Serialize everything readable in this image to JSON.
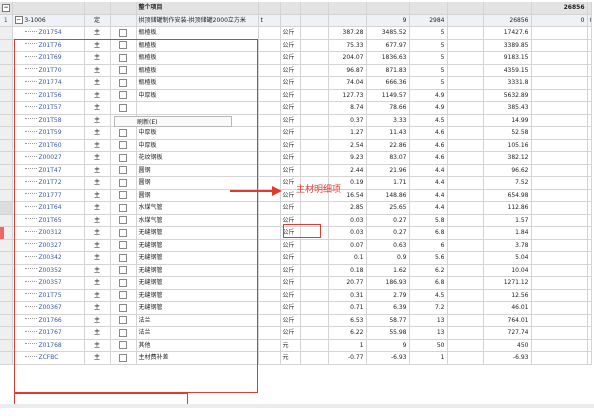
{
  "header": {
    "icon": "−",
    "title": "整个项目",
    "total": "26856"
  },
  "group": {
    "index": "1",
    "code": "3-1006",
    "type": "定",
    "name": "拱顶储罐制作安装-拱顶储罐2000立方米",
    "unit": "t",
    "c1": "9",
    "c2": "2984",
    "c3": "26856",
    "c4": "0",
    "c5": "0"
  },
  "rows": [
    {
      "code": "Z01754",
      "type": "主",
      "name": "瓶楂板",
      "unit": "公斤",
      "q": "387.28",
      "v1": "3485.52",
      "p": "5",
      "t": "17427.6"
    },
    {
      "code": "Z01T76",
      "type": "主",
      "name": "瓶楂板",
      "unit": "公斤",
      "q": "75.33",
      "v1": "677.97",
      "p": "5",
      "t": "3389.85"
    },
    {
      "code": "Z01T69",
      "type": "主",
      "name": "瓶楂板",
      "unit": "公斤",
      "q": "204.07",
      "v1": "1836.63",
      "p": "5",
      "t": "9183.15"
    },
    {
      "code": "Z01T70",
      "type": "主",
      "name": "瓶楂板",
      "unit": "公斤",
      "q": "96.87",
      "v1": "871.83",
      "p": "5",
      "t": "4359.15"
    },
    {
      "code": "Z01774",
      "type": "主",
      "name": "瓶楂板",
      "unit": "公斤",
      "q": "74.04",
      "v1": "666.36",
      "p": "5",
      "t": "3331.8"
    },
    {
      "code": "Z01T56",
      "type": "主",
      "name": "中厚板",
      "unit": "公斤",
      "q": "127.73",
      "v1": "1149.57",
      "p": "4.9",
      "t": "5632.89"
    },
    {
      "code": "Z01T57",
      "type": "主",
      "name": "",
      "unit": "公斤",
      "q": "8.74",
      "v1": "78.66",
      "p": "4.9",
      "t": "385.43"
    },
    {
      "code": "Z01T58",
      "type": "主",
      "name": "中厚板",
      "unit": "公斤",
      "q": "0.37",
      "v1": "3.33",
      "p": "4.5",
      "t": "14.99"
    },
    {
      "code": "Z01T59",
      "type": "主",
      "name": "中厚板",
      "unit": "公斤",
      "q": "1.27",
      "v1": "11.43",
      "p": "4.6",
      "t": "52.58"
    },
    {
      "code": "Z01T60",
      "type": "主",
      "name": "中厚板",
      "unit": "公斤",
      "q": "2.54",
      "v1": "22.86",
      "p": "4.6",
      "t": "105.16"
    },
    {
      "code": "Z00027",
      "type": "主",
      "name": "花纹钢板",
      "unit": "公斤",
      "q": "9.23",
      "v1": "83.07",
      "p": "4.6",
      "t": "382.12"
    },
    {
      "code": "Z01T47",
      "type": "主",
      "name": "圆钢",
      "unit": "公斤",
      "q": "2.44",
      "v1": "21.96",
      "p": "4.4",
      "t": "96.62"
    },
    {
      "code": "Z01T72",
      "type": "主",
      "name": "圆钢",
      "unit": "公斤",
      "q": "0.19",
      "v1": "1.71",
      "p": "4.4",
      "t": "7.52"
    },
    {
      "code": "Z01777",
      "type": "主",
      "name": "圆钢",
      "unit": "公斤",
      "q": "16.54",
      "v1": "148.86",
      "p": "4.4",
      "t": "654.98"
    },
    {
      "code": "Z01T64",
      "type": "主",
      "name": "水煤气管",
      "unit": "公斤",
      "q": "2.85",
      "v1": "25.65",
      "p": "4.4",
      "t": "112.86"
    },
    {
      "code": "Z01T65",
      "type": "主",
      "name": "水煤气管",
      "unit": "公斤",
      "q": "0.03",
      "v1": "0.27",
      "p": "5.8",
      "t": "1.57"
    },
    {
      "code": "Z00312",
      "type": "主",
      "name": "无缝钢管",
      "unit": "公斤",
      "q": "0.03",
      "v1": "0.27",
      "p": "6.8",
      "t": "1.84"
    },
    {
      "code": "Z00327",
      "type": "主",
      "name": "无缝钢管",
      "unit": "公斤",
      "q": "0.07",
      "v1": "0.63",
      "p": "6",
      "t": "3.78"
    },
    {
      "code": "Z00342",
      "type": "主",
      "name": "无缝钢管",
      "unit": "公斤",
      "q": "0.1",
      "v1": "0.9",
      "p": "5.6",
      "t": "5.04"
    },
    {
      "code": "Z00352",
      "type": "主",
      "name": "无缝钢管",
      "unit": "公斤",
      "q": "0.18",
      "v1": "1.62",
      "p": "6.2",
      "t": "10.04"
    },
    {
      "code": "Z00357",
      "type": "主",
      "name": "无缝钢管",
      "unit": "公斤",
      "q": "20.77",
      "v1": "186.93",
      "p": "6.8",
      "t": "1271.12"
    },
    {
      "code": "Z01T75",
      "type": "主",
      "name": "无缝钢管",
      "unit": "公斤",
      "q": "0.31",
      "v1": "2.79",
      "p": "4.5",
      "t": "12.56"
    },
    {
      "code": "Z00367",
      "type": "主",
      "name": "无缝钢管",
      "unit": "公斤",
      "q": "0.71",
      "v1": "6.39",
      "p": "7.2",
      "t": "46.01"
    },
    {
      "code": "Z01766",
      "type": "主",
      "name": "法兰",
      "unit": "公斤",
      "q": "6.53",
      "v1": "58.77",
      "p": "13",
      "t": "764.01"
    },
    {
      "code": "Z01767",
      "type": "主",
      "name": "法兰",
      "unit": "公斤",
      "q": "6.22",
      "v1": "55.98",
      "p": "13",
      "t": "727.74"
    },
    {
      "code": "Z01768",
      "type": "主",
      "name": "其他",
      "unit": "元",
      "q": "1",
      "v1": "9",
      "p": "50",
      "t": "450"
    },
    {
      "code": "ZCFBC",
      "type": "主",
      "name": "主材费补差",
      "unit": "元",
      "q": "-0.77",
      "v1": "-6.93",
      "p": "1",
      "t": "-6.93"
    }
  ],
  "context_menu": {
    "item": "刷新(E)"
  },
  "annotation": {
    "label": "主材明细项"
  },
  "colors": {
    "accent": "#e23a2e"
  }
}
